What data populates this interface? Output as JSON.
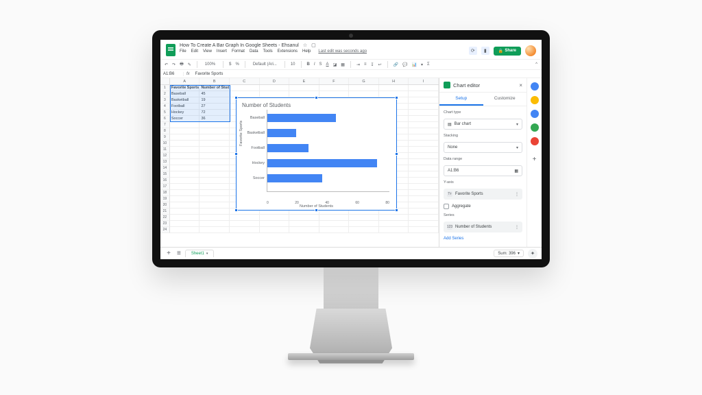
{
  "doc": {
    "title": "How To Create A Bar Graph In Google Sheets - Ehsanul",
    "star": "☆",
    "move": "▢",
    "last_edit": "Last edit was seconds ago"
  },
  "menu": {
    "file": "File",
    "edit": "Edit",
    "view": "View",
    "insert": "Insert",
    "format": "Format",
    "data": "Data",
    "tools": "Tools",
    "extensions": "Extensions",
    "help": "Help"
  },
  "toolbar": {
    "zoom": "100%",
    "font": "Default (Ari...",
    "fontsize": "10"
  },
  "namebox": "A1:B6",
  "fx_value": "Favorite Sports",
  "columns": [
    "A",
    "B",
    "C",
    "D",
    "E",
    "F",
    "G",
    "H",
    "I"
  ],
  "table": {
    "headers": [
      "Favorite Sports",
      "Number of Students"
    ],
    "rows": [
      [
        "Baseball",
        "45"
      ],
      [
        "Basketball",
        "19"
      ],
      [
        "Football",
        "27"
      ],
      [
        "Hockey",
        "72"
      ],
      [
        "Soccer",
        "36"
      ]
    ]
  },
  "chart_data": {
    "type": "bar",
    "title": "Number of Students",
    "ylabel": "Favorite Sports",
    "xlabel": "Number of Students",
    "categories": [
      "Baseball",
      "Basketball",
      "Football",
      "Hockey",
      "Soccer"
    ],
    "values": [
      45,
      19,
      27,
      72,
      36
    ],
    "xticks": [
      "0",
      "20",
      "40",
      "60",
      "80"
    ],
    "xlim": [
      0,
      80
    ]
  },
  "panel": {
    "title": "Chart editor",
    "tabs": {
      "setup": "Setup",
      "customize": "Customize"
    },
    "chart_type_label": "Chart type",
    "chart_type": "Bar chart",
    "stacking_label": "Stacking",
    "stacking": "None",
    "data_range_label": "Data range",
    "data_range": "A1:B6",
    "yaxis_label": "Y-axis",
    "yaxis": "Favorite Sports",
    "aggregate": "Aggregate",
    "series_label": "Series",
    "series": "Number of Students",
    "add_series": "Add Series"
  },
  "tabstrip": {
    "sheet": "Sheet1",
    "sum": "Sum: 396"
  },
  "share": "Share"
}
